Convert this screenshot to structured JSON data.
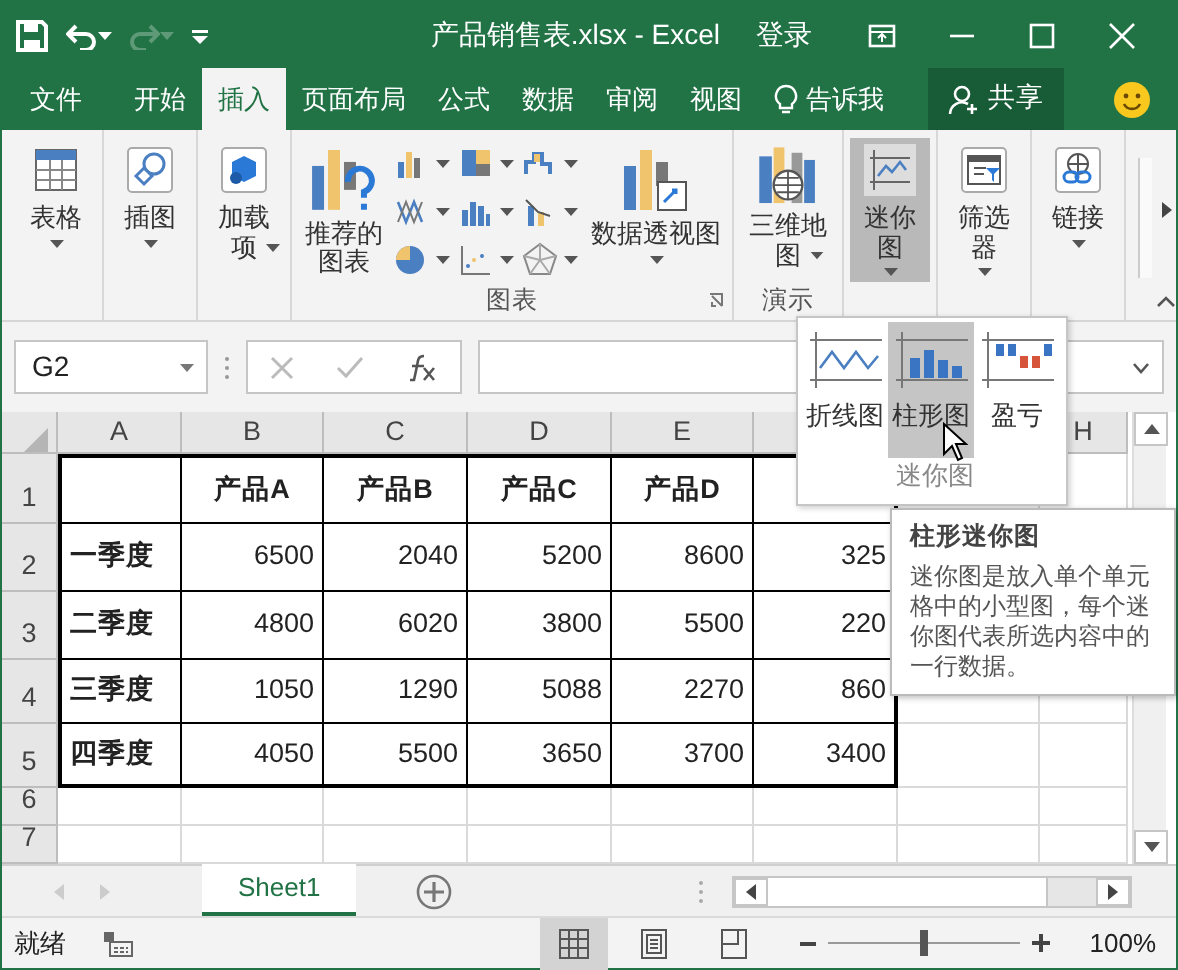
{
  "title_bar": {
    "title": "产品销售表.xlsx - Excel",
    "sign_in": "登录"
  },
  "ribbon_tabs": [
    {
      "label": "文件",
      "selected": false
    },
    {
      "label": "开始",
      "selected": false
    },
    {
      "label": "插入",
      "selected": true
    },
    {
      "label": "页面布局",
      "selected": false
    },
    {
      "label": "公式",
      "selected": false
    },
    {
      "label": "数据",
      "selected": false
    },
    {
      "label": "审阅",
      "selected": false
    },
    {
      "label": "视图",
      "selected": false
    }
  ],
  "tell_me": "告诉我",
  "share": "共享",
  "ribbon_groups": [
    {
      "buttons": [
        {
          "kind": "table",
          "label": "表格",
          "pressed": false
        }
      ]
    },
    {
      "buttons": [
        {
          "kind": "shapes",
          "label": "插图",
          "pressed": false
        }
      ]
    },
    {
      "buttons": [
        {
          "kind": "addin",
          "label": "加载项",
          "pressed": false
        }
      ]
    },
    {
      "label": "图表",
      "buttons": [
        {
          "kind": "recommended",
          "label": "推荐的图表",
          "pressed": false
        },
        {
          "kind": "gallery",
          "pressed": false
        },
        {
          "kind": "pivot",
          "label": "数据透视图",
          "pressed": false
        }
      ]
    },
    {
      "label": "演示",
      "buttons": [
        {
          "kind": "map3d",
          "label": "三维地图",
          "pressed": false
        }
      ]
    },
    {
      "buttons": [
        {
          "kind": "sparkline",
          "label": "迷你图",
          "pressed": true
        }
      ]
    },
    {
      "buttons": [
        {
          "kind": "filter",
          "label": "筛选器",
          "pressed": false
        }
      ]
    },
    {
      "buttons": [
        {
          "kind": "link",
          "label": "链接",
          "pressed": false
        }
      ]
    }
  ],
  "formula_bar": {
    "name_box": "G2"
  },
  "sheet": {
    "column_headers": [
      "A",
      "B",
      "C",
      "D",
      "E"
    ],
    "last_column_header": "H",
    "row_numbers": [
      "1",
      "2",
      "3",
      "4",
      "5",
      "6",
      "7"
    ],
    "header_row": [
      "产品A",
      "产品B",
      "产品C",
      "产品D"
    ],
    "rows": [
      {
        "label": "一季度",
        "values": [
          "6500",
          "2040",
          "5200",
          "8600",
          "325"
        ]
      },
      {
        "label": "二季度",
        "values": [
          "4800",
          "6020",
          "3800",
          "5500",
          "220"
        ]
      },
      {
        "label": "三季度",
        "values": [
          "1050",
          "1290",
          "5088",
          "2270",
          "860"
        ]
      },
      {
        "label": "四季度",
        "values": [
          "4050",
          "5500",
          "3650",
          "3700",
          "3400"
        ]
      }
    ]
  },
  "sheet_tabs": [
    {
      "label": "Sheet1",
      "selected": true
    }
  ],
  "status_bar": {
    "status": "就绪",
    "views": [
      {
        "kind": "normal",
        "selected": true
      },
      {
        "kind": "layout",
        "selected": false
      },
      {
        "kind": "pagebreak",
        "selected": false
      }
    ],
    "zoom": {
      "level": 0.5,
      "reading": "100%"
    }
  },
  "sparkline_menu": {
    "items": [
      {
        "kind": "line",
        "label": "折线图",
        "hovered": false
      },
      {
        "kind": "column",
        "label": "柱形图",
        "hovered": true
      },
      {
        "kind": "winloss",
        "label": "盈亏",
        "hovered": false
      }
    ],
    "group_label": "迷你图"
  },
  "tooltip": {
    "title": "柱形迷你图",
    "text": "迷你图是放入单个单元格中的小型图，每个迷你图代表所选内容中的一行数据。"
  }
}
